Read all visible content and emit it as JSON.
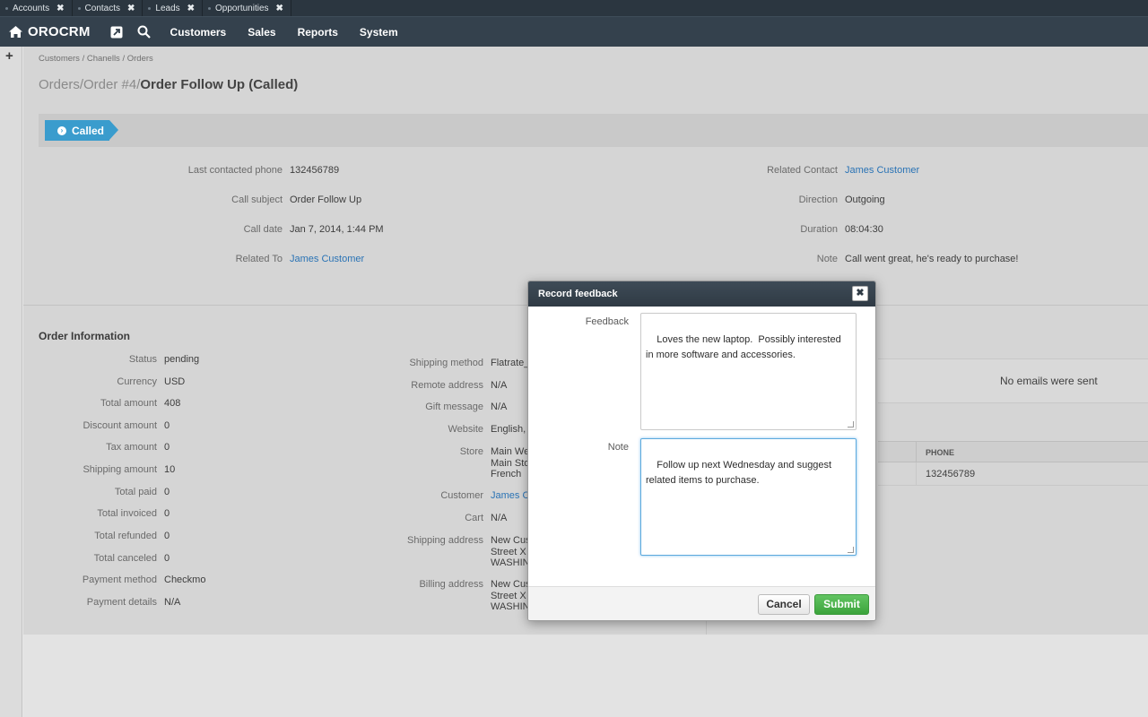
{
  "pinned_tabs": [
    {
      "label": "Accounts",
      "close": "✖"
    },
    {
      "label": "Contacts",
      "close": "✖"
    },
    {
      "label": "Leads",
      "close": "✖"
    },
    {
      "label": "Opportunities",
      "close": "✖"
    }
  ],
  "header": {
    "brand": "OROCRM",
    "menu": [
      "Customers",
      "Sales",
      "Reports",
      "System"
    ]
  },
  "rail": {
    "add": "+"
  },
  "breadcrumb": "Customers / Chanells / Orders",
  "title": {
    "part1": "Orders",
    "sep1": "/",
    "part2": "Order #4",
    "sep2": "/",
    "current": "Order Follow Up (Called)"
  },
  "status": {
    "label": "Called",
    "icon": "›"
  },
  "call": {
    "left": [
      {
        "label": "Last contacted phone",
        "value": "132456789"
      },
      {
        "label": "Call subject",
        "value": "Order Follow Up"
      },
      {
        "label": "Call date",
        "value": "Jan 7, 2014, 1:44 PM"
      },
      {
        "label": "Related To",
        "value": "James Customer"
      }
    ],
    "right": [
      {
        "label": "Related Contact",
        "value": "James Customer"
      },
      {
        "label": "Direction",
        "value": "Outgoing"
      },
      {
        "label": "Duration",
        "value": "08:04:30"
      },
      {
        "label": "Note",
        "value": "Call went great, he's ready to purchase!"
      }
    ]
  },
  "order": {
    "section_title": "Order Information",
    "left": [
      {
        "label": "Status",
        "value": "pending"
      },
      {
        "label": "Currency",
        "value": "USD"
      },
      {
        "label": "Total amount",
        "value": "408"
      },
      {
        "label": "Discount amount",
        "value": "0"
      },
      {
        "label": "Tax amount",
        "value": "0"
      },
      {
        "label": "Shipping amount",
        "value": "10"
      },
      {
        "label": "Total paid",
        "value": "0"
      },
      {
        "label": "Total invoiced",
        "value": "0"
      },
      {
        "label": "Total refunded",
        "value": "0"
      },
      {
        "label": "Total canceled",
        "value": "0"
      },
      {
        "label": "Payment method",
        "value": "Checkmo"
      },
      {
        "label": "Payment details",
        "value": "N/A"
      }
    ],
    "right": [
      {
        "label": "Shipping method",
        "value": "Flatrate_"
      },
      {
        "label": "Remote address",
        "value": "N/A"
      },
      {
        "label": "Gift message",
        "value": "N/A"
      },
      {
        "label": "Website",
        "value": "English,"
      },
      {
        "label": "Store",
        "value": "Main We\nMain Sto\nFrench"
      },
      {
        "label": "Customer",
        "value": "James C"
      },
      {
        "label": "Cart",
        "value": "N/A"
      },
      {
        "label": "Shipping address",
        "value": "New Cus\nStreet X\nWASHIN"
      },
      {
        "label": "Billing address",
        "value": "New Cus\nStreet X\nWASHIN"
      }
    ]
  },
  "emails": {
    "empty": "No emails were sent"
  },
  "phones": {
    "header": "PHONE",
    "value": "132456789"
  },
  "modal": {
    "title": "Record feedback",
    "close": "✖",
    "feedback_label": "Feedback",
    "feedback_value": "Loves the new laptop.  Possibly interested in more software and accessories.",
    "note_label": "Note",
    "note_value": "Follow up next Wednesday and suggest related items to purchase.",
    "cancel": "Cancel",
    "submit": "Submit"
  }
}
